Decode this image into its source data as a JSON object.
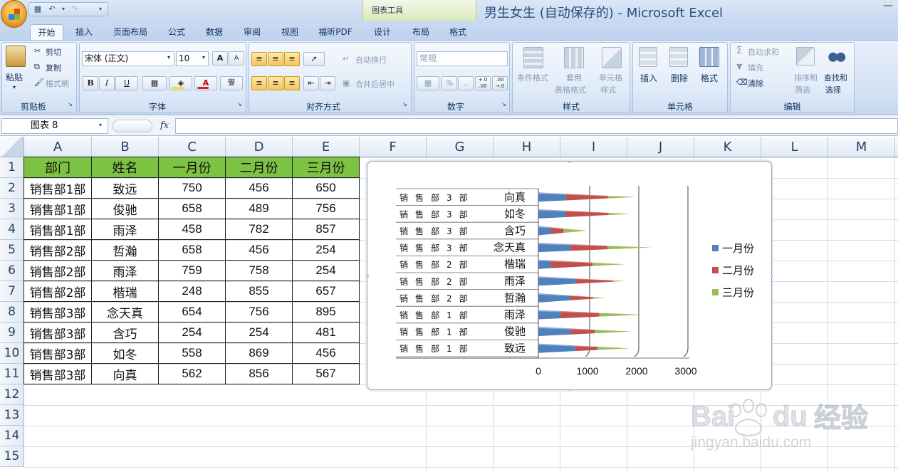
{
  "window": {
    "title": "男生女生 (自动保存的) - Microsoft Excel",
    "context_tab_group": "图表工具"
  },
  "tabs": [
    "开始",
    "插入",
    "页面布局",
    "公式",
    "数据",
    "审阅",
    "视图",
    "福昕PDF",
    "设计",
    "布局",
    "格式"
  ],
  "active_tab": "开始",
  "ribbon": {
    "clipboard": {
      "group": "剪贴板",
      "paste": "粘贴",
      "cut": "剪切",
      "copy": "复制",
      "format_painter": "格式刷"
    },
    "font": {
      "group": "字体",
      "font_name": "宋体 (正文)",
      "font_size": "10",
      "bold": "B",
      "italic": "I",
      "underline": "U",
      "grow": "A",
      "shrink": "A",
      "phonetic": "燮"
    },
    "alignment": {
      "group": "对齐方式",
      "wrap_text": "自动换行",
      "merge_center": "合并后居中"
    },
    "number": {
      "group": "数字",
      "format": "常规",
      "percent": "%",
      "comma": ",",
      "inc_decimal": "+.0 .00",
      "dec_decimal": ".00 →.0"
    },
    "styles": {
      "group": "样式",
      "conditional": "条件格式",
      "table_format_1": "套用",
      "table_format_2": "表格格式",
      "cell_styles_1": "单元格",
      "cell_styles_2": "样式"
    },
    "cells": {
      "group": "单元格",
      "insert": "插入",
      "delete": "删除",
      "format": "格式"
    },
    "editing": {
      "group": "编辑",
      "autosum": "自动求和",
      "fill": "填充",
      "clear": "清除",
      "sort_filter_1": "排序和",
      "sort_filter_2": "筛选",
      "find_select_1": "查找和",
      "find_select_2": "选择"
    }
  },
  "formula_bar": {
    "name_box": "图表 8",
    "fx": "fx",
    "formula": ""
  },
  "columns": [
    "A",
    "B",
    "C",
    "D",
    "E",
    "F",
    "G",
    "H",
    "I",
    "J",
    "K",
    "L",
    "M"
  ],
  "rows": [
    "1",
    "2",
    "3",
    "4",
    "5",
    "6",
    "7",
    "8",
    "9",
    "10",
    "11",
    "12",
    "13",
    "14",
    "15"
  ],
  "sheet": {
    "headers": [
      "部门",
      "姓名",
      "一月份",
      "二月份",
      "三月份"
    ],
    "rows": [
      [
        "销售部1部",
        "致远",
        "750",
        "456",
        "650"
      ],
      [
        "销售部1部",
        "俊驰",
        "658",
        "489",
        "756"
      ],
      [
        "销售部1部",
        "雨泽",
        "458",
        "782",
        "857"
      ],
      [
        "销售部2部",
        "哲瀚",
        "658",
        "456",
        "254"
      ],
      [
        "销售部2部",
        "雨泽",
        "759",
        "758",
        "254"
      ],
      [
        "销售部2部",
        "楷瑞",
        "248",
        "855",
        "657"
      ],
      [
        "销售部3部",
        "念天真",
        "654",
        "756",
        "895"
      ],
      [
        "销售部3部",
        "含巧",
        "254",
        "254",
        "481"
      ],
      [
        "销售部3部",
        "如冬",
        "558",
        "869",
        "456"
      ],
      [
        "销售部3部",
        "向真",
        "562",
        "856",
        "567"
      ]
    ]
  },
  "colors": {
    "header_fill": "#7dc243",
    "series_1": "#4f81bd",
    "series_2": "#c0504d",
    "series_3": "#9bbb59"
  },
  "chart_data": {
    "type": "bar",
    "orientation": "horizontal",
    "stacked": true,
    "shape": "cone-3d",
    "categories": [
      "向真",
      "如冬",
      "含巧",
      "念天真",
      "楷瑞",
      "雨泽",
      "哲瀚",
      "雨泽",
      "俊驰",
      "致远"
    ],
    "group_labels": [
      "销售部3部",
      "销售部3部",
      "销售部3部",
      "销售部3部",
      "销售部2部",
      "销售部2部",
      "销售部2部",
      "销售部1部",
      "销售部1部",
      "销售部1部"
    ],
    "series": [
      {
        "name": "一月份",
        "values": [
          562,
          558,
          254,
          654,
          248,
          759,
          658,
          458,
          658,
          750
        ]
      },
      {
        "name": "二月份",
        "values": [
          856,
          869,
          254,
          756,
          855,
          758,
          456,
          782,
          489,
          456
        ]
      },
      {
        "name": "三月份",
        "values": [
          567,
          456,
          481,
          895,
          657,
          254,
          254,
          857,
          756,
          650
        ]
      }
    ],
    "xlim": [
      0,
      3000
    ],
    "x_ticks": [
      "0",
      "1000",
      "2000",
      "3000"
    ],
    "legend": "right",
    "grid": true
  },
  "watermark": {
    "text": "Baidu经验",
    "sub": "jingyan.baidu.com"
  }
}
